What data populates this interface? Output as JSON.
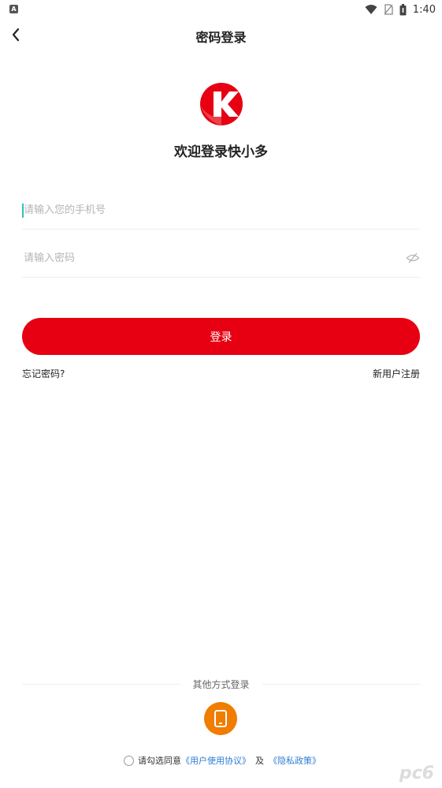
{
  "status_bar": {
    "time": "1:40",
    "left_icon": "A",
    "icons": [
      "wifi-icon",
      "no-sim-icon",
      "battery-icon"
    ]
  },
  "nav": {
    "title": "密码登录",
    "back_icon": "chevron-left-icon"
  },
  "brand": {
    "welcome": "欢迎登录快小多",
    "accent_color": "#e60012"
  },
  "form": {
    "phone_placeholder": "请输入您的手机号",
    "phone_value": "",
    "password_placeholder": "请输入密码",
    "password_value": "",
    "eye_icon": "eye-hidden-icon"
  },
  "actions": {
    "login_label": "登录",
    "forgot_label": "忘记密码?",
    "register_label": "新用户注册"
  },
  "other_login": {
    "label": "其他方式登录",
    "phone_icon": "phone-icon",
    "phone_color": "#f07c00"
  },
  "agreement": {
    "prefix": "请勾选同意",
    "user_agreement": "《用户使用协议》",
    "and": "及",
    "privacy": "《隐私政策》",
    "link_color": "#2d7cd6"
  },
  "watermark": "pc6"
}
